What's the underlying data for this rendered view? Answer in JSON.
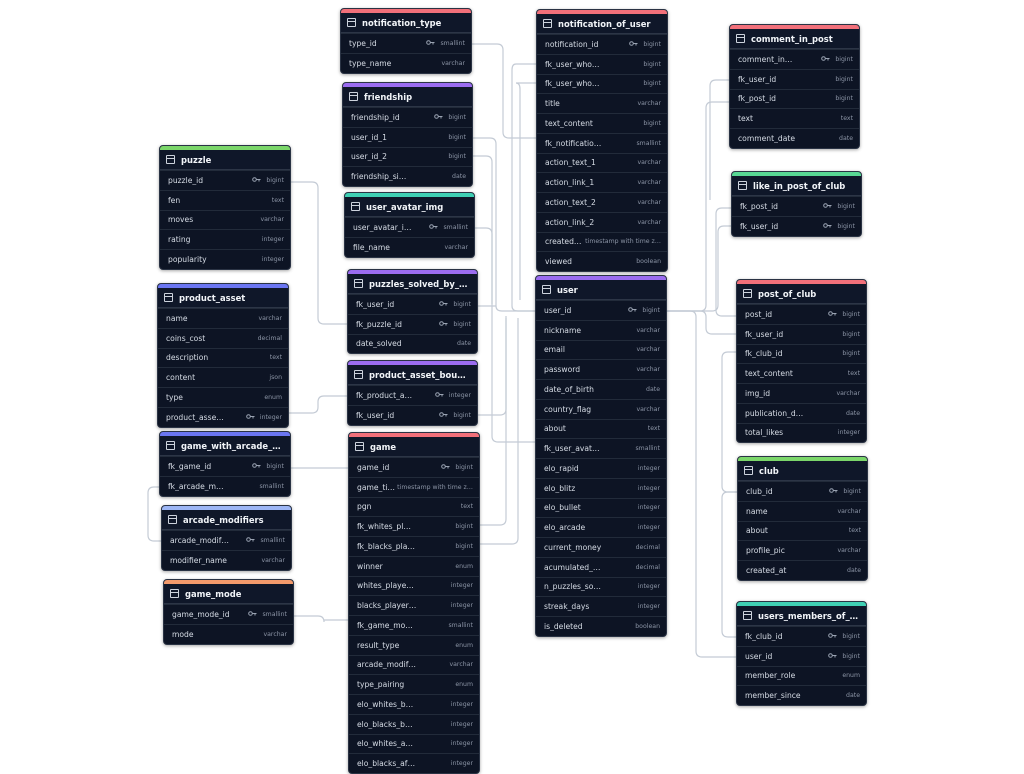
{
  "colors": {
    "green": "#7bd66a",
    "pink": "#f2707a",
    "purple": "#9b6cf0",
    "indigo": "#6b76f2",
    "blue": "#9db6f5",
    "orange": "#f39a6b",
    "teal": "#3fd0b4",
    "mint": "#58d894"
  },
  "tables": {
    "notification_type": {
      "name": "notification_type",
      "color": "pink",
      "columns": [
        {
          "name": "type_id",
          "type": "smallint",
          "key": true
        },
        {
          "name": "type_name",
          "type": "varchar",
          "key": false
        }
      ]
    },
    "notification_of_user": {
      "name": "notification_of_user",
      "color": "pink",
      "columns": [
        {
          "name": "notification_id",
          "type": "bigint",
          "key": true
        },
        {
          "name": "fk_user_who…",
          "type": "bigint",
          "key": false
        },
        {
          "name": "fk_user_who…",
          "type": "bigint",
          "key": false
        },
        {
          "name": "title",
          "type": "varchar",
          "key": false
        },
        {
          "name": "text_content",
          "type": "bigint",
          "key": false
        },
        {
          "name": "fk_notificatio…",
          "type": "smallint",
          "key": false
        },
        {
          "name": "action_text_1",
          "type": "varchar",
          "key": false
        },
        {
          "name": "action_link_1",
          "type": "varchar",
          "key": false
        },
        {
          "name": "action_text_2",
          "type": "varchar",
          "key": false
        },
        {
          "name": "action_link_2",
          "type": "varchar",
          "key": false
        },
        {
          "name": "created…",
          "type": "timestamp with time z…",
          "key": false
        },
        {
          "name": "viewed",
          "type": "boolean",
          "key": false
        }
      ]
    },
    "comment_in_post": {
      "name": "comment_in_post",
      "color": "pink",
      "columns": [
        {
          "name": "comment_in…",
          "type": "bigint",
          "key": true
        },
        {
          "name": "fk_user_id",
          "type": "bigint",
          "key": false
        },
        {
          "name": "fk_post_id",
          "type": "bigint",
          "key": false
        },
        {
          "name": "text",
          "type": "text",
          "key": false
        },
        {
          "name": "comment_date",
          "type": "date",
          "key": false
        }
      ]
    },
    "friendship": {
      "name": "friendship",
      "color": "purple",
      "columns": [
        {
          "name": "friendship_id",
          "type": "bigint",
          "key": true
        },
        {
          "name": "user_id_1",
          "type": "bigint",
          "key": false
        },
        {
          "name": "user_id_2",
          "type": "bigint",
          "key": false
        },
        {
          "name": "friendship_si…",
          "type": "date",
          "key": false
        }
      ]
    },
    "puzzle": {
      "name": "puzzle",
      "color": "green",
      "columns": [
        {
          "name": "puzzle_id",
          "type": "bigint",
          "key": true
        },
        {
          "name": "fen",
          "type": "text",
          "key": false
        },
        {
          "name": "moves",
          "type": "varchar",
          "key": false
        },
        {
          "name": "rating",
          "type": "integer",
          "key": false
        },
        {
          "name": "popularity",
          "type": "integer",
          "key": false
        }
      ]
    },
    "like_in_post_of_club": {
      "name": "like_in_post_of_club",
      "color": "mint",
      "columns": [
        {
          "name": "fk_post_id",
          "type": "bigint",
          "key": true
        },
        {
          "name": "fk_user_id",
          "type": "bigint",
          "key": true
        }
      ]
    },
    "user_avatar_img": {
      "name": "user_avatar_img",
      "color": "teal",
      "columns": [
        {
          "name": "user_avatar_i…",
          "type": "smallint",
          "key": true
        },
        {
          "name": "file_name",
          "type": "varchar",
          "key": false
        }
      ]
    },
    "puzzles_solved_by_user": {
      "name": "puzzles_solved_by_user",
      "color": "purple",
      "columns": [
        {
          "name": "fk_user_id",
          "type": "bigint",
          "key": true
        },
        {
          "name": "fk_puzzle_id",
          "type": "bigint",
          "key": true
        },
        {
          "name": "date_solved",
          "type": "date",
          "key": false
        }
      ]
    },
    "user": {
      "name": "user",
      "color": "purple",
      "columns": [
        {
          "name": "user_id",
          "type": "bigint",
          "key": true
        },
        {
          "name": "nickname",
          "type": "varchar",
          "key": false
        },
        {
          "name": "email",
          "type": "varchar",
          "key": false
        },
        {
          "name": "password",
          "type": "varchar",
          "key": false
        },
        {
          "name": "date_of_birth",
          "type": "date",
          "key": false
        },
        {
          "name": "country_flag",
          "type": "varchar",
          "key": false
        },
        {
          "name": "about",
          "type": "text",
          "key": false
        },
        {
          "name": "fk_user_avat…",
          "type": "smallint",
          "key": false
        },
        {
          "name": "elo_rapid",
          "type": "integer",
          "key": false
        },
        {
          "name": "elo_blitz",
          "type": "integer",
          "key": false
        },
        {
          "name": "elo_bullet",
          "type": "integer",
          "key": false
        },
        {
          "name": "elo_arcade",
          "type": "integer",
          "key": false
        },
        {
          "name": "current_money",
          "type": "decimal",
          "key": false
        },
        {
          "name": "acumulated_…",
          "type": "decimal",
          "key": false
        },
        {
          "name": "n_puzzles_so…",
          "type": "integer",
          "key": false
        },
        {
          "name": "streak_days",
          "type": "integer",
          "key": false
        },
        {
          "name": "is_deleted",
          "type": "boolean",
          "key": false
        }
      ]
    },
    "post_of_club": {
      "name": "post_of_club",
      "color": "pink",
      "columns": [
        {
          "name": "post_id",
          "type": "bigint",
          "key": true
        },
        {
          "name": "fk_user_id",
          "type": "bigint",
          "key": false
        },
        {
          "name": "fk_club_id",
          "type": "bigint",
          "key": false
        },
        {
          "name": "text_content",
          "type": "text",
          "key": false
        },
        {
          "name": "img_id",
          "type": "varchar",
          "key": false
        },
        {
          "name": "publication_d…",
          "type": "date",
          "key": false
        },
        {
          "name": "total_likes",
          "type": "integer",
          "key": false
        }
      ]
    },
    "product_asset": {
      "name": "product_asset",
      "color": "indigo",
      "columns": [
        {
          "name": "name",
          "type": "varchar",
          "key": false
        },
        {
          "name": "coins_cost",
          "type": "decimal",
          "key": false
        },
        {
          "name": "description",
          "type": "text",
          "key": false
        },
        {
          "name": "content",
          "type": "json",
          "key": false
        },
        {
          "name": "type",
          "type": "enum",
          "key": false
        },
        {
          "name": "product_asse…",
          "type": "integer",
          "key": true
        }
      ]
    },
    "product_asset_bought_by_user": {
      "name": "product_asset_bought_by…",
      "color": "purple",
      "columns": [
        {
          "name": "fk_product_a…",
          "type": "integer",
          "key": true
        },
        {
          "name": "fk_user_id",
          "type": "bigint",
          "key": true
        }
      ]
    },
    "game_with_arcade_modifier": {
      "name": "game_with_arcade_modif…",
      "color": "indigo",
      "columns": [
        {
          "name": "fk_game_id",
          "type": "bigint",
          "key": true
        },
        {
          "name": "fk_arcade_m…",
          "type": "smallint",
          "key": false
        }
      ]
    },
    "game": {
      "name": "game",
      "color": "pink",
      "columns": [
        {
          "name": "game_id",
          "type": "bigint",
          "key": true
        },
        {
          "name": "game_ti…",
          "type": "timestamp with time z…",
          "key": false
        },
        {
          "name": "pgn",
          "type": "text",
          "key": false
        },
        {
          "name": "fk_whites_pl…",
          "type": "bigint",
          "key": false
        },
        {
          "name": "fk_blacks_pla…",
          "type": "bigint",
          "key": false
        },
        {
          "name": "winner",
          "type": "enum",
          "key": false
        },
        {
          "name": "whites_playe…",
          "type": "integer",
          "key": false
        },
        {
          "name": "blacks_player…",
          "type": "integer",
          "key": false
        },
        {
          "name": "fk_game_mo…",
          "type": "smallint",
          "key": false
        },
        {
          "name": "result_type",
          "type": "enum",
          "key": false
        },
        {
          "name": "arcade_modif…",
          "type": "varchar",
          "key": false
        },
        {
          "name": "type_pairing",
          "type": "enum",
          "key": false
        },
        {
          "name": "elo_whites_b…",
          "type": "integer",
          "key": false
        },
        {
          "name": "elo_blacks_b…",
          "type": "integer",
          "key": false
        },
        {
          "name": "elo_whites_a…",
          "type": "integer",
          "key": false
        },
        {
          "name": "elo_blacks_af…",
          "type": "integer",
          "key": false
        }
      ]
    },
    "club": {
      "name": "club",
      "color": "green",
      "columns": [
        {
          "name": "club_id",
          "type": "bigint",
          "key": true
        },
        {
          "name": "name",
          "type": "varchar",
          "key": false
        },
        {
          "name": "about",
          "type": "text",
          "key": false
        },
        {
          "name": "profile_pic",
          "type": "varchar",
          "key": false
        },
        {
          "name": "created_at",
          "type": "date",
          "key": false
        }
      ]
    },
    "arcade_modifiers": {
      "name": "arcade_modifiers",
      "color": "blue",
      "columns": [
        {
          "name": "arcade_modif…",
          "type": "smallint",
          "key": true
        },
        {
          "name": "modifier_name",
          "type": "varchar",
          "key": false
        }
      ]
    },
    "game_mode": {
      "name": "game_mode",
      "color": "orange",
      "columns": [
        {
          "name": "game_mode_id",
          "type": "smallint",
          "key": true
        },
        {
          "name": "mode",
          "type": "varchar",
          "key": false
        }
      ]
    },
    "users_members_of_club": {
      "name": "users_members_of_club",
      "color": "teal",
      "columns": [
        {
          "name": "fk_club_id",
          "type": "bigint",
          "key": true
        },
        {
          "name": "user_id",
          "type": "bigint",
          "key": true
        },
        {
          "name": "member_role",
          "type": "enum",
          "key": false
        },
        {
          "name": "member_since",
          "type": "date",
          "key": false
        }
      ]
    }
  }
}
